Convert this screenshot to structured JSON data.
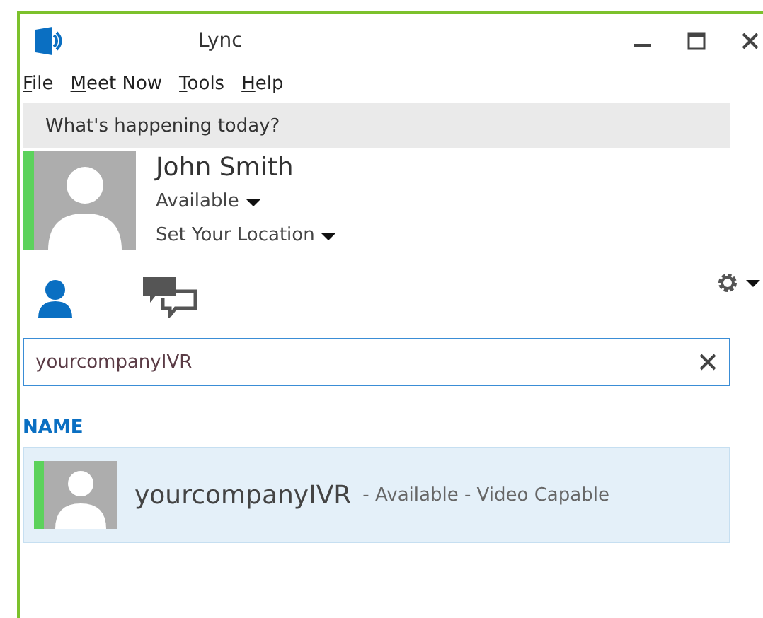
{
  "window": {
    "title": "Lync"
  },
  "menu": [
    {
      "label": "File"
    },
    {
      "label": "Meet Now"
    },
    {
      "label": "Tools"
    },
    {
      "label": "Help"
    }
  ],
  "note": {
    "placeholder": "What's happening today?"
  },
  "me": {
    "name": "John Smith",
    "status": "Available",
    "location": "Set Your Location",
    "color": "#5cd25c"
  },
  "tabs": [
    {
      "kind": "contacts",
      "selected": true
    },
    {
      "kind": "conversations",
      "selected": false
    }
  ],
  "search": {
    "value": "yourcompanyIVR"
  },
  "results": {
    "heading": "NAME",
    "rows": [
      {
        "name": "yourcompanyIVR",
        "detail": "- Available - Video Capable",
        "color": "#5cd25c",
        "selected": true
      }
    ]
  }
}
